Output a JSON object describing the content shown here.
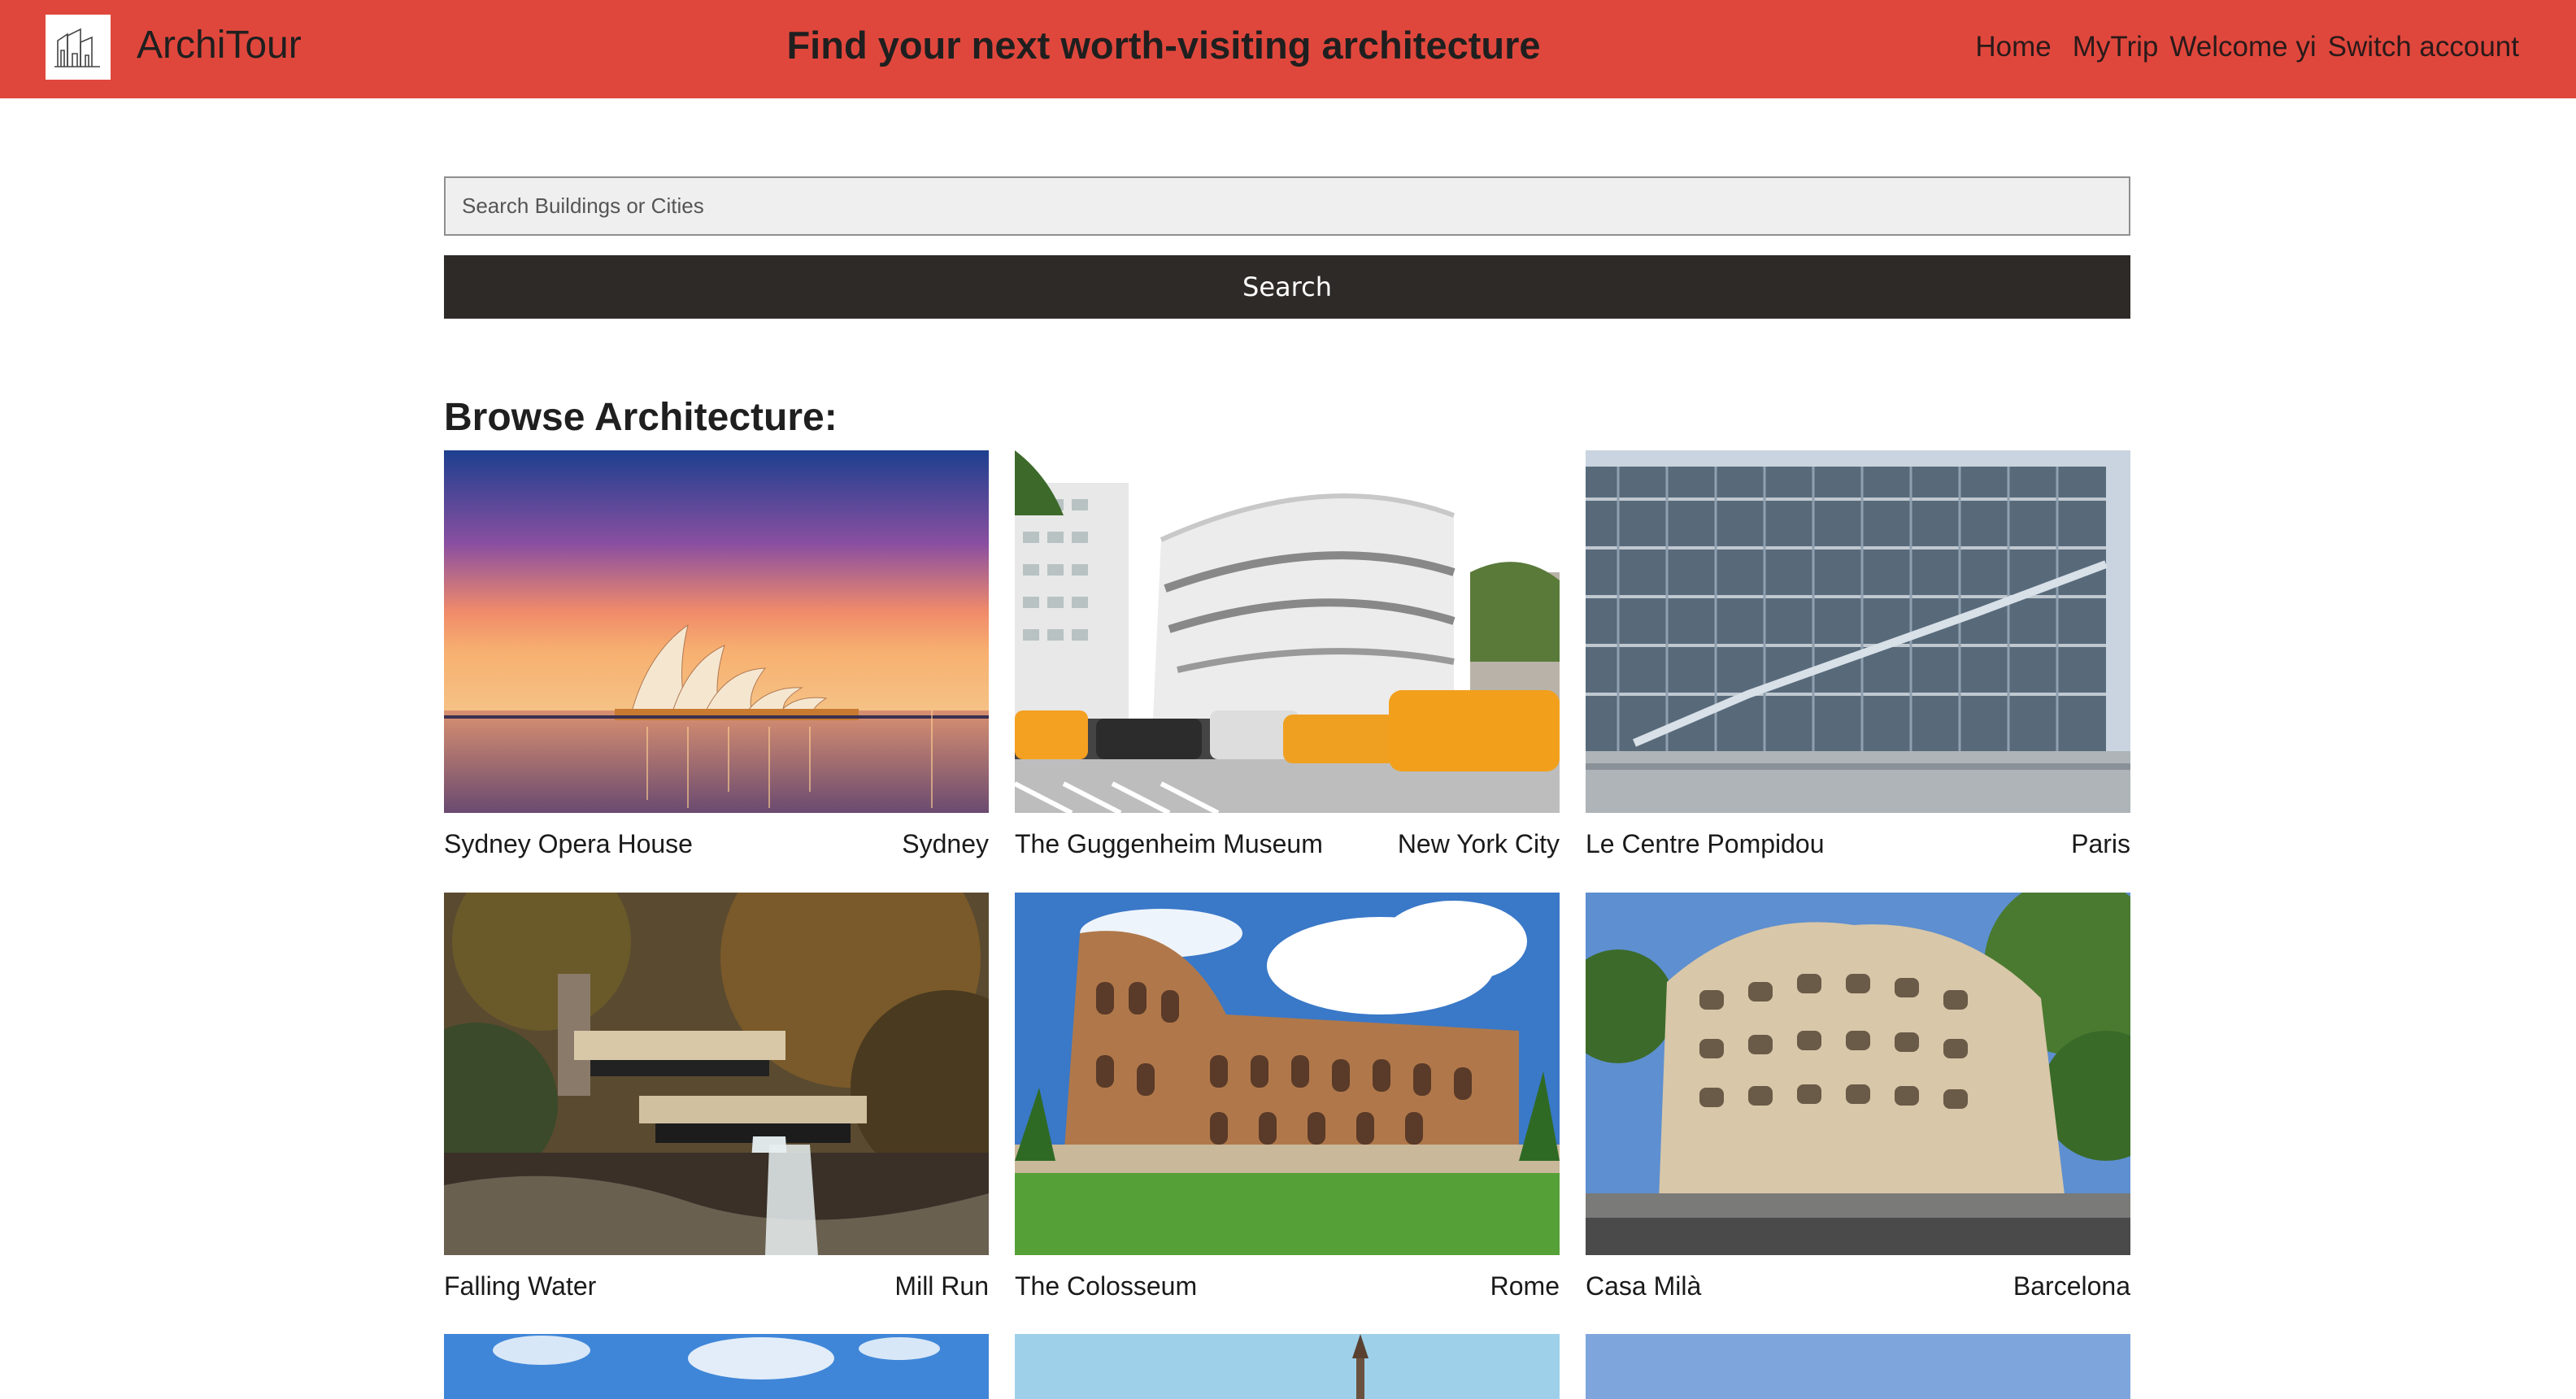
{
  "header": {
    "brand": "ArchiTour",
    "tagline": "Find your next worth-visiting architecture",
    "nav": {
      "home": "Home",
      "mytrip": "MyTrip",
      "welcome": "Welcome yi",
      "switch": "Switch account"
    },
    "logo_icon": "buildings-icon",
    "bg_color": "#e0473c"
  },
  "search": {
    "placeholder": "Search Buildings or Cities",
    "value": "",
    "button_label": "Search"
  },
  "browse": {
    "title": "Browse Architecture:",
    "items": [
      {
        "name": "Sydney Opera House",
        "city": "Sydney"
      },
      {
        "name": "The Guggenheim Museum",
        "city": "New York City"
      },
      {
        "name": "Le Centre Pompidou",
        "city": "Paris"
      },
      {
        "name": "Falling Water",
        "city": "Mill Run"
      },
      {
        "name": "The Colosseum",
        "city": "Rome"
      },
      {
        "name": "Casa Milà",
        "city": "Barcelona"
      }
    ]
  }
}
